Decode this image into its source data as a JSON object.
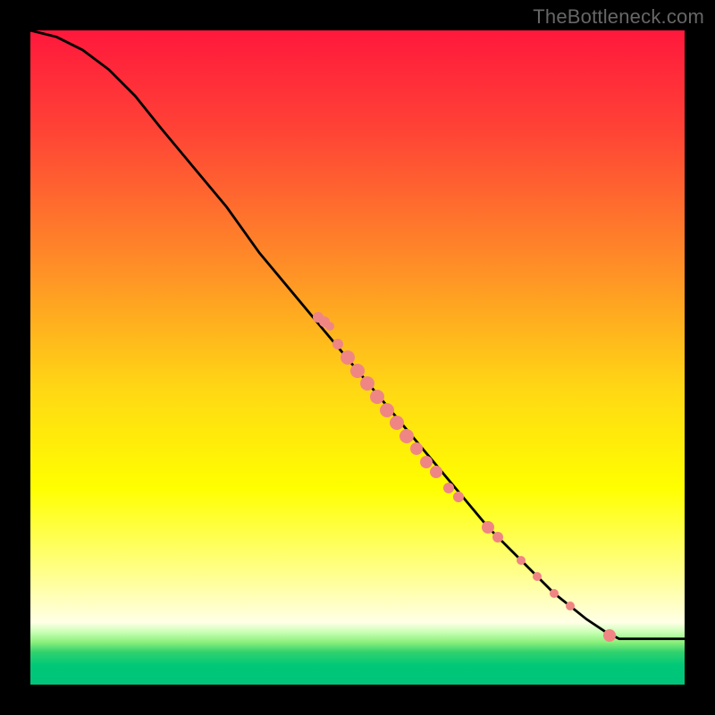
{
  "watermark": {
    "text": "TheBottleneck.com"
  },
  "colors": {
    "gradient_stops": [
      {
        "offset": 0,
        "color": "#ff183c"
      },
      {
        "offset": 0.15,
        "color": "#ff4236"
      },
      {
        "offset": 0.35,
        "color": "#ff8a28"
      },
      {
        "offset": 0.55,
        "color": "#ffd814"
      },
      {
        "offset": 0.7,
        "color": "#ffff00"
      },
      {
        "offset": 0.83,
        "color": "#ffff8c"
      },
      {
        "offset": 0.88,
        "color": "#ffffc8"
      },
      {
        "offset": 0.905,
        "color": "#ffffe6"
      },
      {
        "offset": 0.92,
        "color": "#c8ffb4"
      },
      {
        "offset": 0.935,
        "color": "#8cf07c"
      },
      {
        "offset": 0.95,
        "color": "#32d26e"
      },
      {
        "offset": 0.97,
        "color": "#00c878"
      },
      {
        "offset": 1.0,
        "color": "#00c47a"
      }
    ],
    "curve": "#000000",
    "marker": "#ef8683",
    "background": "#000000"
  },
  "chart_data": {
    "type": "line",
    "title": "",
    "xlabel": "",
    "ylabel": "",
    "xlim": [
      0,
      100
    ],
    "ylim": [
      0,
      100
    ],
    "series": [
      {
        "name": "curve",
        "x": [
          0,
          4,
          8,
          12,
          16,
          20,
          25,
          30,
          35,
          40,
          45,
          50,
          55,
          60,
          65,
          70,
          75,
          80,
          85,
          88,
          90,
          92,
          94,
          96,
          98,
          100
        ],
        "y": [
          100,
          99,
          97,
          94,
          90,
          85,
          79,
          73,
          66,
          60,
          54,
          48,
          42,
          36,
          30,
          24,
          19,
          14,
          10,
          8,
          7,
          7,
          7,
          7,
          7,
          7
        ]
      }
    ],
    "markers": [
      {
        "x": 45.0,
        "y": 55.5,
        "size": 12
      },
      {
        "x": 44.0,
        "y": 56.2,
        "size": 12
      },
      {
        "x": 45.7,
        "y": 54.8,
        "size": 10
      },
      {
        "x": 47.0,
        "y": 52.0,
        "size": 12
      },
      {
        "x": 48.5,
        "y": 50.0,
        "size": 16
      },
      {
        "x": 50.0,
        "y": 48.0,
        "size": 16
      },
      {
        "x": 51.5,
        "y": 46.0,
        "size": 16
      },
      {
        "x": 53.0,
        "y": 44.0,
        "size": 16
      },
      {
        "x": 54.5,
        "y": 42.0,
        "size": 16
      },
      {
        "x": 56.0,
        "y": 40.0,
        "size": 16
      },
      {
        "x": 57.5,
        "y": 38.0,
        "size": 16
      },
      {
        "x": 59.0,
        "y": 36.0,
        "size": 14
      },
      {
        "x": 60.5,
        "y": 34.0,
        "size": 14
      },
      {
        "x": 62.0,
        "y": 32.5,
        "size": 14
      },
      {
        "x": 64.0,
        "y": 30.0,
        "size": 12
      },
      {
        "x": 65.5,
        "y": 28.7,
        "size": 12
      },
      {
        "x": 70.0,
        "y": 24.0,
        "size": 14
      },
      {
        "x": 71.5,
        "y": 22.5,
        "size": 12
      },
      {
        "x": 75.0,
        "y": 19.0,
        "size": 10
      },
      {
        "x": 77.5,
        "y": 16.5,
        "size": 10
      },
      {
        "x": 80.0,
        "y": 14.0,
        "size": 10
      },
      {
        "x": 82.5,
        "y": 12.0,
        "size": 10
      },
      {
        "x": 88.5,
        "y": 7.5,
        "size": 14
      }
    ]
  }
}
